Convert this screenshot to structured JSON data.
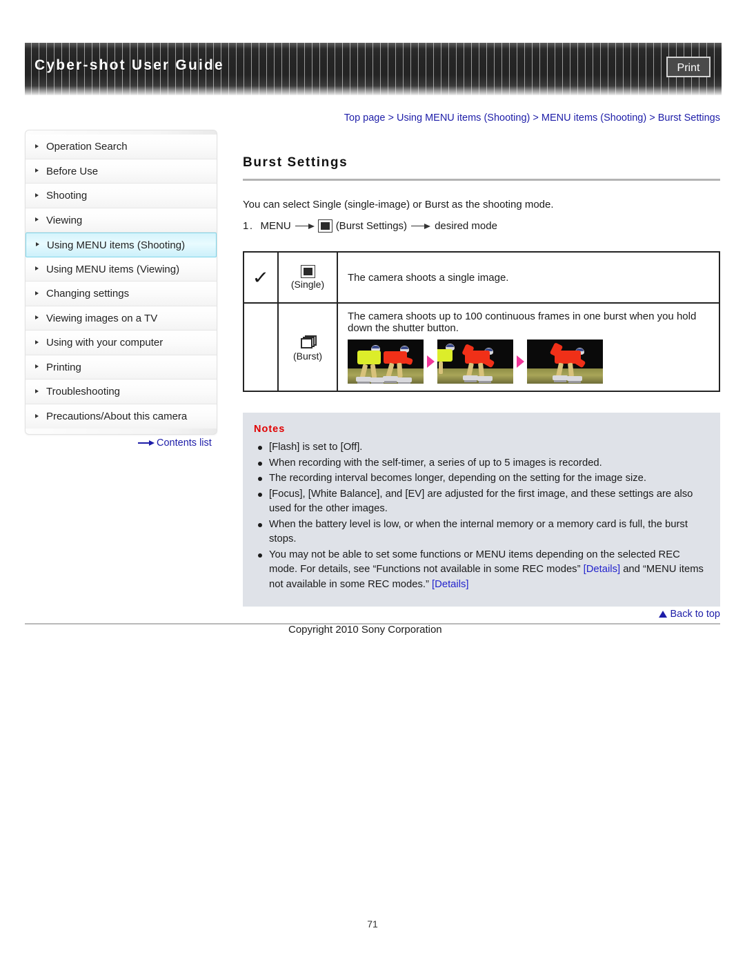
{
  "header": {
    "title": "Cyber-shot User Guide",
    "print_label": "Print"
  },
  "breadcrumb": {
    "items": [
      "Top page",
      "Using MENU items (Shooting)",
      "MENU items (Shooting)",
      "Burst Settings"
    ],
    "separator": " > ",
    "full_text": "Top page > Using MENU items (Shooting) > MENU items (Shooting) > Burst Settings"
  },
  "sidebar": {
    "items": [
      {
        "label": "Operation Search",
        "active": false
      },
      {
        "label": "Before Use",
        "active": false
      },
      {
        "label": "Shooting",
        "active": false
      },
      {
        "label": "Viewing",
        "active": false
      },
      {
        "label": "Using MENU items (Shooting)",
        "active": true
      },
      {
        "label": "Using MENU items (Viewing)",
        "active": false
      },
      {
        "label": "Changing settings",
        "active": false
      },
      {
        "label": "Viewing images on a TV",
        "active": false
      },
      {
        "label": "Using with your computer",
        "active": false
      },
      {
        "label": "Printing",
        "active": false
      },
      {
        "label": "Troubleshooting",
        "active": false
      },
      {
        "label": "Precautions/About this camera",
        "active": false
      }
    ],
    "contents_link": "Contents list"
  },
  "main": {
    "heading": "Burst Settings",
    "intro": "You can select Single (single-image) or Burst as the shooting mode.",
    "step": {
      "number": "1.",
      "menu_label": "MENU",
      "icon_name": "single-image-icon",
      "setting_label": "(Burst Settings)",
      "result_label": "desired mode"
    },
    "table": {
      "rows": [
        {
          "checked": true,
          "check_glyph": "✓",
          "icon": "single-image-icon",
          "mode_label": "(Single)",
          "description": "The camera shoots a single image.",
          "has_images": false
        },
        {
          "checked": false,
          "check_glyph": "",
          "icon": "burst-stack-icon",
          "mode_label": "(Burst)",
          "description": "The camera shoots up to 100 continuous frames in one burst when you hold down the shutter button.",
          "has_images": true,
          "image_count": 3,
          "image_alt": "Sequence of three burst photos of inline speed skaters"
        }
      ]
    },
    "notes": {
      "title": "Notes",
      "items": [
        {
          "text": "[Flash] is set to [Off]."
        },
        {
          "text": "When recording with the self-timer, a series of up to 5 images is recorded."
        },
        {
          "text": "The recording interval becomes longer, depending on the setting for the image size."
        },
        {
          "text": "[Focus], [White Balance], and [EV] are adjusted for the first image, and these settings are also used for the other images."
        },
        {
          "text": "When the battery level is low, or when the internal memory or a memory card is full, the burst stops."
        },
        {
          "rich": true,
          "part1": "You may not be able to set some functions or MENU items depending on the selected REC mode. For details, see “Functions not available in some REC modes” ",
          "link1": "[Details]",
          "part2": " and “MENU items not available in some REC modes.” ",
          "link2": "[Details]"
        }
      ]
    }
  },
  "footer": {
    "back_to_top": "Back to top",
    "copyright": "Copyright 2010 Sony Corporation",
    "page_number": "71"
  },
  "colors": {
    "link": "#1d1da8",
    "notes_title": "#e00000",
    "details_link": "#2222cc",
    "active_nav": "#7fd6ea",
    "notes_bg": "#dfe2e8",
    "arrow_pink": "#f2369a"
  }
}
